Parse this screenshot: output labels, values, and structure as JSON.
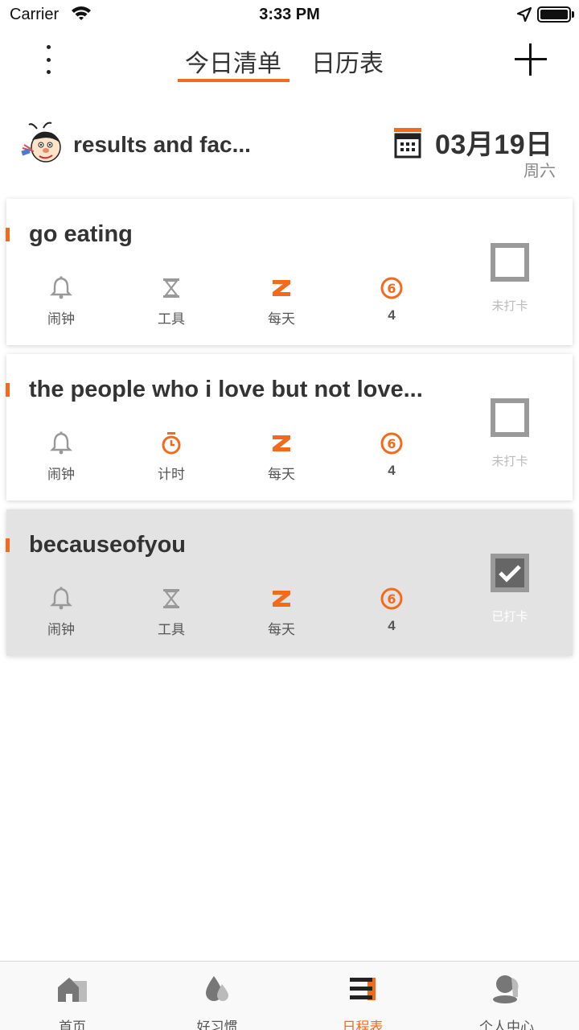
{
  "status_bar": {
    "carrier": "Carrier",
    "time": "3:33 PM"
  },
  "nav": {
    "tabs": [
      {
        "label": "今日清单",
        "active": true
      },
      {
        "label": "日历表",
        "active": false
      }
    ]
  },
  "header": {
    "list_title": "results and fac...",
    "date": "03月19日",
    "weekday": "周六"
  },
  "cards": [
    {
      "title": "go eating",
      "features": [
        "闹钟",
        "工具",
        "每天",
        "4"
      ],
      "status": "未打卡",
      "checked": false
    },
    {
      "title": "the people who i love but not love...",
      "features": [
        "闹钟",
        "计时",
        "每天",
        "4"
      ],
      "status": "未打卡",
      "checked": false
    },
    {
      "title": "becauseofyou",
      "features": [
        "闹钟",
        "工具",
        "每天",
        "4"
      ],
      "status": "已打卡",
      "checked": true
    }
  ],
  "bottom_tabs": [
    {
      "label": "首页",
      "icon": "home-icon"
    },
    {
      "label": "好习惯",
      "icon": "drop-icon"
    },
    {
      "label": "日程表",
      "icon": "schedule-icon",
      "active": true
    },
    {
      "label": "个人中心",
      "icon": "profile-icon"
    }
  ],
  "colors": {
    "accent": "#f26b1d",
    "text": "#333333",
    "muted": "#888888",
    "checked_bg": "#e3e3e3"
  }
}
